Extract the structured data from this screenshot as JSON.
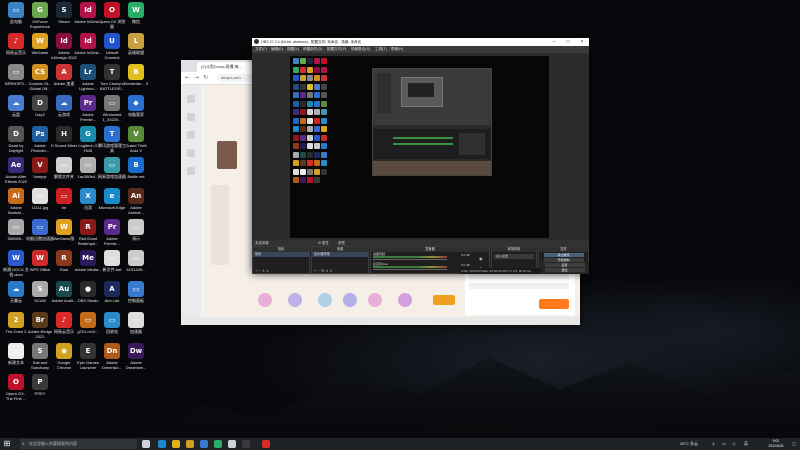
{
  "desktop": {
    "icons": [
      {
        "label": "此电脑",
        "glyph": "▭",
        "color": "#3b82c4"
      },
      {
        "label": "GeForce Experience",
        "glyph": "G",
        "color": "#6aa84f"
      },
      {
        "label": "Steam",
        "glyph": "S",
        "color": "#1b2838"
      },
      {
        "label": "Adobe InDesi...",
        "glyph": "Id",
        "color": "#b3124a"
      },
      {
        "label": "Opera GX 浏览器",
        "glyph": "O",
        "color": "#c0102a"
      },
      {
        "label": "微信",
        "glyph": "W",
        "color": "#2aae67"
      },
      {
        "label": "网易云音乐",
        "glyph": "♪",
        "color": "#d82a2a"
      },
      {
        "label": "WeGame",
        "glyph": "W",
        "color": "#e0a020"
      },
      {
        "label": "Adobe InDesign 2022",
        "glyph": "Id",
        "color": "#8a0f3e"
      },
      {
        "label": "Adobe InDesi...",
        "glyph": "Id",
        "color": "#b3124a"
      },
      {
        "label": "Ubisoft Connect",
        "glyph": "U",
        "color": "#2255cc"
      },
      {
        "label": "英雄联盟",
        "glyph": "L",
        "color": "#c8a040"
      },
      {
        "label": "BRRNSF3...",
        "glyph": "▭",
        "color": "#888888"
      },
      {
        "label": "Counter-St... Global Off...",
        "glyph": "CS",
        "color": "#d09020"
      },
      {
        "label": "Adobe 加速",
        "glyph": "A",
        "color": "#cc3333"
      },
      {
        "label": "Adobe Lightroo...",
        "glyph": "Lr",
        "color": "#1f4e79"
      },
      {
        "label": "Tom Clancy's BATTLEGR...",
        "glyph": "T",
        "color": "#333333"
      },
      {
        "label": "Borderlan... 3",
        "glyph": "B",
        "color": "#e0c020"
      },
      {
        "label": "云盘",
        "glyph": "☁",
        "color": "#4a7bd0"
      },
      {
        "label": "DayZ",
        "glyph": "D",
        "color": "#444444"
      },
      {
        "label": "云游戏",
        "glyph": "☁",
        "color": "#3a6ac0"
      },
      {
        "label": "Adobe Premie...",
        "glyph": "Pr",
        "color": "#5b2a8a"
      },
      {
        "label": "Windowed 1_20220...",
        "glyph": "▭",
        "color": "#777777"
      },
      {
        "label": "电脑管家",
        "glyph": "◆",
        "color": "#2a70d0"
      },
      {
        "label": "Dead by Daylight",
        "glyph": "D",
        "color": "#555555"
      },
      {
        "label": "Adobe Photosh...",
        "glyph": "Ps",
        "color": "#1f5f9f"
      },
      {
        "label": "H Sound Mixer",
        "glyph": "H",
        "color": "#2a2a2a"
      },
      {
        "label": "Logitech G HUB",
        "glyph": "G",
        "color": "#1a8aaa"
      },
      {
        "label": "腾讯游戏管理工具",
        "glyph": "T",
        "color": "#2a70d0"
      },
      {
        "label": "Grand Theft Auto V",
        "glyph": "V",
        "color": "#5a8a3a"
      },
      {
        "label": "Adobe After Effects 2022",
        "glyph": "Ae",
        "color": "#3a2a7a"
      },
      {
        "label": "Vampyr",
        "glyph": "V",
        "color": "#8a1a1a"
      },
      {
        "label": "解锁文件夹",
        "glyph": "▭",
        "color": "#d0d0d0"
      },
      {
        "label": "1ac380b4...",
        "glyph": "▭",
        "color": "#b0b0b0"
      },
      {
        "label": "网易游戏加速器",
        "glyph": "▭",
        "color": "#3a9aaa"
      },
      {
        "label": "Battle.net",
        "glyph": "B",
        "color": "#1a6acc"
      },
      {
        "label": "Adobe Illustrat...",
        "glyph": "Ai",
        "color": "#c86a1a"
      },
      {
        "label": "11111.jpg",
        "glyph": "▭",
        "color": "#e0e0e0"
      },
      {
        "label": "tm",
        "glyph": "▭",
        "color": "#cc2222"
      },
      {
        "label": "迅游",
        "glyph": "X",
        "color": "#2a8acc"
      },
      {
        "label": "Microsoft Edge",
        "glyph": "e",
        "color": "#1a8acc"
      },
      {
        "label": "Adobe Animat...",
        "glyph": "An",
        "color": "#5a2a1a"
      },
      {
        "label": "555555...",
        "glyph": "▭",
        "color": "#aaaaaa"
      },
      {
        "label": "电脑迅雷加速器",
        "glyph": "▭",
        "color": "#3a6ad0"
      },
      {
        "label": "WeGame版",
        "glyph": "W",
        "color": "#e0a020"
      },
      {
        "label": "Red Dead Redempti...",
        "glyph": "R",
        "color": "#8a1a1a"
      },
      {
        "label": "Adobe Premie...",
        "glyph": "Pr",
        "color": "#5b2a8a"
      },
      {
        "label": "演示",
        "glyph": "▭",
        "color": "#cccccc"
      },
      {
        "label": "新建 DOCX 文档.docx",
        "glyph": "W",
        "color": "#2a5acc"
      },
      {
        "label": "WPS Office",
        "glyph": "W",
        "color": "#cc2a2a"
      },
      {
        "label": "Rust",
        "glyph": "R",
        "color": "#8a3a1a"
      },
      {
        "label": "Adobe Media...",
        "glyph": "Me",
        "color": "#2a1a5a"
      },
      {
        "label": "新文件.bat",
        "glyph": "▭",
        "color": "#dddddd"
      },
      {
        "label": "6131445...",
        "glyph": "▭",
        "color": "#cccccc"
      },
      {
        "label": "天翼云",
        "glyph": "☁",
        "color": "#2a7acc"
      },
      {
        "label": "SCUM",
        "glyph": "S",
        "color": "#aaaaaa"
      },
      {
        "label": "Adobe Audit...",
        "glyph": "Au",
        "color": "#1a4a4a"
      },
      {
        "label": "OBS Studio",
        "glyph": "●",
        "color": "#2a2a2a"
      },
      {
        "label": "Aim Lab",
        "glyph": "A",
        "color": "#1a2a5a"
      },
      {
        "label": "控制面板",
        "glyph": "▭",
        "color": "#3a7acc"
      },
      {
        "label": "The Crew 2",
        "glyph": "2",
        "color": "#d0a020"
      },
      {
        "label": "Adobe Bridge 2022",
        "glyph": "Br",
        "color": "#5a3a1a"
      },
      {
        "label": "网易云音乐",
        "glyph": "♪",
        "color": "#d82a2a"
      },
      {
        "label": "g701-m10...",
        "glyph": "▭",
        "color": "#c06a1a"
      },
      {
        "label": "回收站",
        "glyph": "▭",
        "color": "#2a8acc"
      },
      {
        "label": "加速器",
        "glyph": "▭",
        "color": "#dddddd"
      },
      {
        "label": "新建文本",
        "glyph": "▭",
        "color": "#eeeeee"
      },
      {
        "label": "Salt and Sanctuary",
        "glyph": "S",
        "color": "#777777"
      },
      {
        "label": "Google Chrome",
        "glyph": "◉",
        "color": "#d0a020"
      },
      {
        "label": "Epic Games Launcher",
        "glyph": "E",
        "color": "#333333"
      },
      {
        "label": "Adobe Dimensio...",
        "glyph": "Dn",
        "color": "#b05a1a"
      },
      {
        "label": "Adobe Dreamwe...",
        "glyph": "Dw",
        "color": "#3a1a5a"
      },
      {
        "label": "Opera GX - The First ...",
        "glyph": "O",
        "color": "#c0102a"
      },
      {
        "label": "PREY",
        "glyph": "P",
        "color": "#3a3a3a"
      }
    ]
  },
  "browser": {
    "tab_title": "(2)斗鱼Douyu直播-每...",
    "url": "douyu.com"
  },
  "obs": {
    "title": "OBS 27.2.4 (64-bit, windows) - 配置文件: 未命名 - 场景: 未命名",
    "menu": [
      "文件(F)",
      "编辑(E)",
      "视图(V)",
      "停靠部件(D)",
      "配置文件(P)",
      "场景集合(S)",
      "工具(T)",
      "帮助(H)"
    ],
    "source_bar": {
      "label": "未选择源",
      "props": "⚙ 属性",
      "filters": "滤镜"
    },
    "docks": {
      "scenes": {
        "header": "场景",
        "item": "场景"
      },
      "sources": {
        "header": "来源",
        "item": "显示器采集"
      },
      "mixer": {
        "header": "混音器",
        "rows": [
          "桌面音频",
          "麦克风/Aux"
        ],
        "db": [
          "0.0 dB",
          "0.0 dB"
        ]
      },
      "transitions": {
        "header": "转场特效",
        "value": "淡入淡出"
      },
      "controls": {
        "header": "控件",
        "buttons": [
          "停止推流",
          "开始录制",
          "启动虚拟摄像机",
          "工作室模式",
          "设置",
          "退出"
        ]
      }
    },
    "status": "LIVE: 00:00:00  REC: 00:00:00  CPU: 2.1%, 30.00 fps"
  },
  "taskbar": {
    "search_placeholder": "在这里输入你要搜索的内容",
    "weather": "28°C 多云",
    "lang": "英",
    "time": "8:02",
    "date": "2022/6/24",
    "apps": [
      {
        "name": "task-view-icon",
        "color": "#cfd3d8"
      },
      {
        "name": "edge-icon",
        "color": "#1a8acc"
      },
      {
        "name": "file-explorer-icon",
        "color": "#e0b020"
      },
      {
        "name": "chrome-icon",
        "color": "#d0a020"
      },
      {
        "name": "store-icon",
        "color": "#3a7acc"
      },
      {
        "name": "wechat-icon",
        "color": "#2aae67"
      },
      {
        "name": "mail-icon",
        "color": "#cfd3d8"
      },
      {
        "name": "obs-taskbar-icon",
        "color": "#3a3a3a"
      },
      {
        "name": "netease-icon",
        "color": "#d82a2a"
      }
    ]
  }
}
